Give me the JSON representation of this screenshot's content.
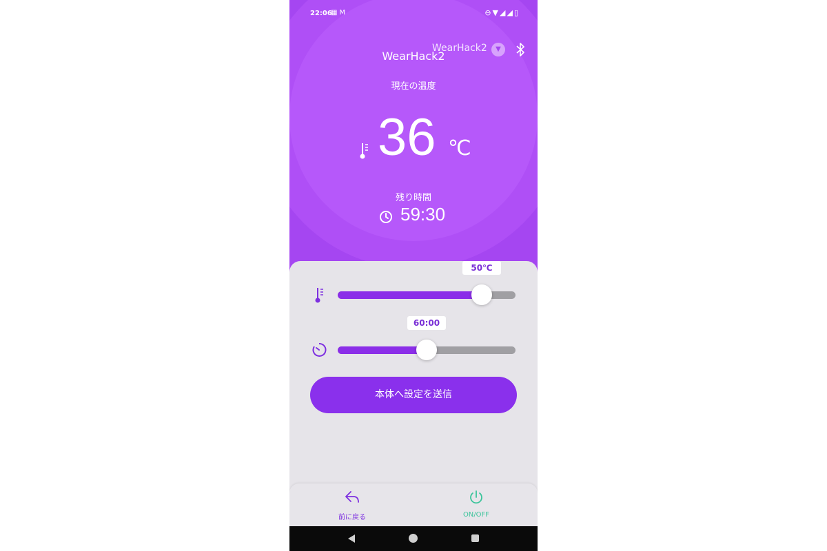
{
  "status_bar": {
    "time": "22:06",
    "left_icons": [
      "calendar-icon",
      "gmail-icon"
    ],
    "right_icons": [
      "dnd-icon",
      "wifi-icon",
      "signal-icon",
      "signal-2-icon",
      "battery-icon"
    ]
  },
  "header": {
    "device_selector": "WearHack2",
    "title": "WearHack2"
  },
  "current_temp": {
    "label": "現在の温度",
    "value": "36",
    "unit": "℃"
  },
  "remaining": {
    "label": "残り時間",
    "time": "59:30"
  },
  "controls": {
    "temperature_slider": {
      "value_label": "50℃",
      "fraction": 0.81
    },
    "timer_slider": {
      "value_label": "60:00",
      "fraction": 0.5
    },
    "send_button": "本体へ設定を送信"
  },
  "bottom_nav": {
    "back_label": "前に戻る",
    "power_label": "ON/OFF"
  },
  "colors": {
    "hero": "#a546f1",
    "accent": "#8a30ec",
    "power": "#3cc49b"
  }
}
